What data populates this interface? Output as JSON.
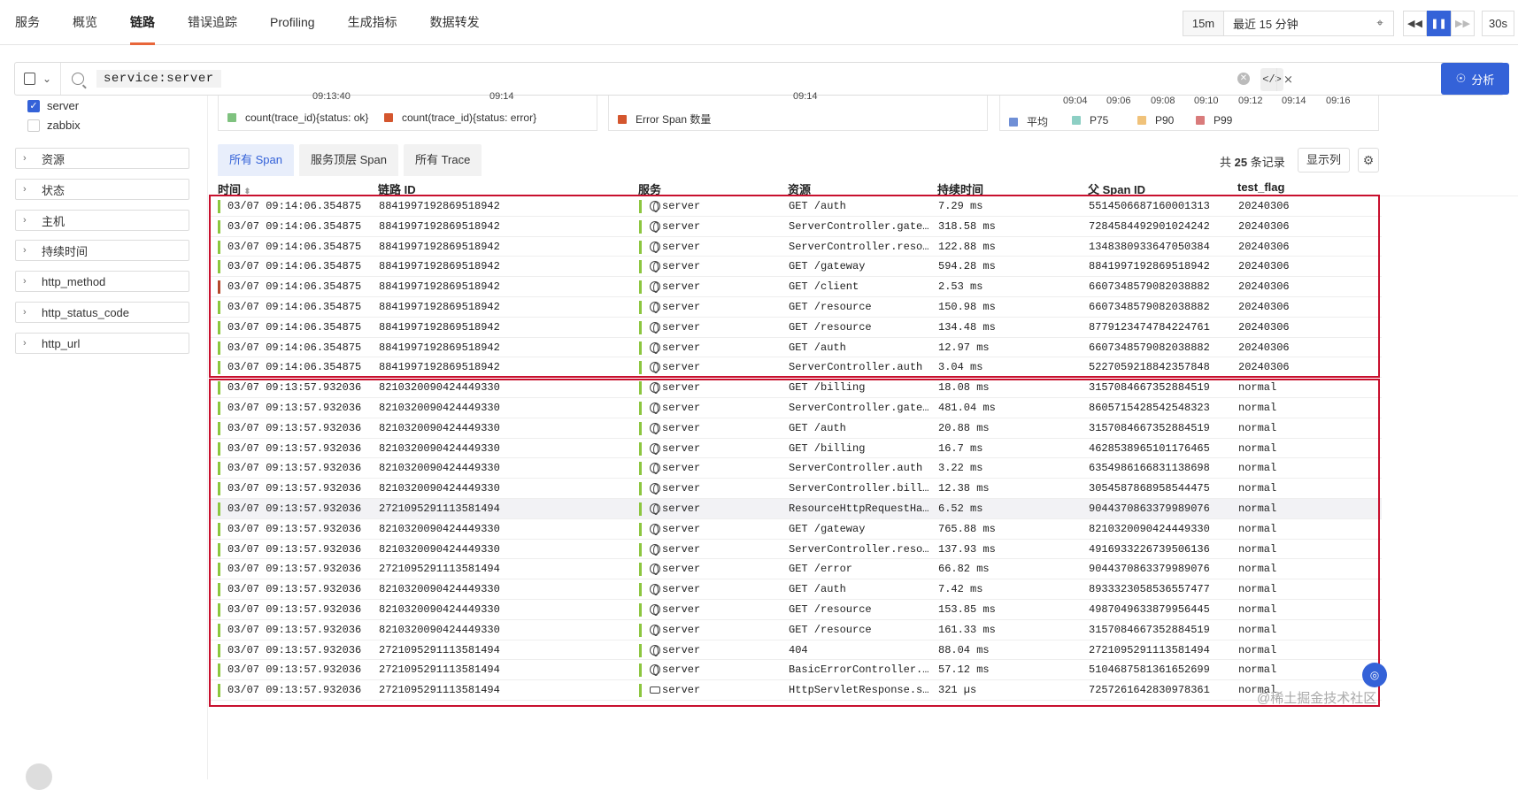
{
  "nav": {
    "tabs": [
      "服务",
      "概览",
      "链路",
      "错误追踪",
      "Profiling",
      "生成指标",
      "数据转发"
    ],
    "active": "链路"
  },
  "timectl": {
    "short": "15m",
    "range": "最近 15 分钟",
    "refresh": "30s"
  },
  "search": {
    "query": "service:server"
  },
  "analyze": {
    "label": "分析"
  },
  "sidebar": {
    "checks": [
      {
        "label": "server",
        "checked": true
      },
      {
        "label": "zabbix",
        "checked": false
      }
    ],
    "facets": [
      "资源",
      "状态",
      "主机",
      "持续时间",
      "http_method",
      "http_status_code",
      "http_url"
    ]
  },
  "charts": [
    {
      "ticks": [
        "09:13:40",
        "09:14"
      ],
      "legend": [
        {
          "name": "count(trace_id){status: ok}",
          "color": "#7fc27f"
        },
        {
          "name": "count(trace_id){status: error}",
          "color": "#d4562e"
        }
      ]
    },
    {
      "ticks": [
        "09:14"
      ],
      "legend": [
        {
          "name": "Error Span 数量",
          "color": "#d4562e"
        }
      ]
    },
    {
      "ticks": [
        "09:04",
        "09:06",
        "09:08",
        "09:10",
        "09:12",
        "09:14",
        "09:16"
      ],
      "legend": [
        {
          "name": "平均",
          "color": "#6f8fd6"
        },
        {
          "name": "P75",
          "color": "#8dcfc4"
        },
        {
          "name": "P90",
          "color": "#f0c27a"
        },
        {
          "name": "P99",
          "color": "#d97b7b"
        }
      ]
    }
  ],
  "subtabs": [
    "所有 Span",
    "服务顶层 Span",
    "所有 Trace"
  ],
  "records": {
    "prefix": "共",
    "count": "25",
    "suffix": "条记录"
  },
  "showcols": "显示列",
  "table": {
    "headers": [
      "时间",
      "链路 ID",
      "服务",
      "资源",
      "持续时间",
      "父 Span ID",
      "test_flag"
    ],
    "rows": [
      {
        "time": "03/07 09:14:06.354875",
        "trace": "8841997192869518942",
        "svc": "server",
        "res": "GET /auth",
        "dur": "7.29 ms",
        "parent": "5514506687160001313",
        "flag": "20240306",
        "err": false
      },
      {
        "time": "03/07 09:14:06.354875",
        "trace": "8841997192869518942",
        "svc": "server",
        "res": "ServerController.gate…",
        "dur": "318.58 ms",
        "parent": "7284584492901024242",
        "flag": "20240306",
        "err": false
      },
      {
        "time": "03/07 09:14:06.354875",
        "trace": "8841997192869518942",
        "svc": "server",
        "res": "ServerController.reso…",
        "dur": "122.88 ms",
        "parent": "1348380933647050384",
        "flag": "20240306",
        "err": false
      },
      {
        "time": "03/07 09:14:06.354875",
        "trace": "8841997192869518942",
        "svc": "server",
        "res": "GET /gateway",
        "dur": "594.28 ms",
        "parent": "8841997192869518942",
        "flag": "20240306",
        "err": false
      },
      {
        "time": "03/07 09:14:06.354875",
        "trace": "8841997192869518942",
        "svc": "server",
        "res": "GET /client",
        "dur": "2.53 ms",
        "parent": "6607348579082038882",
        "flag": "20240306",
        "err": true
      },
      {
        "time": "03/07 09:14:06.354875",
        "trace": "8841997192869518942",
        "svc": "server",
        "res": "GET /resource",
        "dur": "150.98 ms",
        "parent": "6607348579082038882",
        "flag": "20240306",
        "err": false
      },
      {
        "time": "03/07 09:14:06.354875",
        "trace": "8841997192869518942",
        "svc": "server",
        "res": "GET /resource",
        "dur": "134.48 ms",
        "parent": "8779123474784224761",
        "flag": "20240306",
        "err": false
      },
      {
        "time": "03/07 09:14:06.354875",
        "trace": "8841997192869518942",
        "svc": "server",
        "res": "GET /auth",
        "dur": "12.97 ms",
        "parent": "6607348579082038882",
        "flag": "20240306",
        "err": false
      },
      {
        "time": "03/07 09:14:06.354875",
        "trace": "8841997192869518942",
        "svc": "server",
        "res": "ServerController.auth",
        "dur": "3.04 ms",
        "parent": "5227059218842357848",
        "flag": "20240306",
        "err": false
      },
      {
        "time": "03/07 09:13:57.932036",
        "trace": "8210320090424449330",
        "svc": "server",
        "res": "GET /billing",
        "dur": "18.08 ms",
        "parent": "3157084667352884519",
        "flag": "normal",
        "err": false
      },
      {
        "time": "03/07 09:13:57.932036",
        "trace": "8210320090424449330",
        "svc": "server",
        "res": "ServerController.gate…",
        "dur": "481.04 ms",
        "parent": "8605715428542548323",
        "flag": "normal",
        "err": false
      },
      {
        "time": "03/07 09:13:57.932036",
        "trace": "8210320090424449330",
        "svc": "server",
        "res": "GET /auth",
        "dur": "20.88 ms",
        "parent": "3157084667352884519",
        "flag": "normal",
        "err": false
      },
      {
        "time": "03/07 09:13:57.932036",
        "trace": "8210320090424449330",
        "svc": "server",
        "res": "GET /billing",
        "dur": "16.7 ms",
        "parent": "4628538965101176465",
        "flag": "normal",
        "err": false
      },
      {
        "time": "03/07 09:13:57.932036",
        "trace": "8210320090424449330",
        "svc": "server",
        "res": "ServerController.auth",
        "dur": "3.22 ms",
        "parent": "6354986166831138698",
        "flag": "normal",
        "err": false
      },
      {
        "time": "03/07 09:13:57.932036",
        "trace": "8210320090424449330",
        "svc": "server",
        "res": "ServerController.bill…",
        "dur": "12.38 ms",
        "parent": "3054587868958544475",
        "flag": "normal",
        "err": false
      },
      {
        "time": "03/07 09:13:57.932036",
        "trace": "2721095291113581494",
        "svc": "server",
        "res": "ResourceHttpRequestHa…",
        "dur": "6.52 ms",
        "parent": "9044370863379989076",
        "flag": "normal",
        "err": false
      },
      {
        "time": "03/07 09:13:57.932036",
        "trace": "8210320090424449330",
        "svc": "server",
        "res": "GET /gateway",
        "dur": "765.88 ms",
        "parent": "8210320090424449330",
        "flag": "normal",
        "err": false
      },
      {
        "time": "03/07 09:13:57.932036",
        "trace": "8210320090424449330",
        "svc": "server",
        "res": "ServerController.reso…",
        "dur": "137.93 ms",
        "parent": "4916933226739506136",
        "flag": "normal",
        "err": false
      },
      {
        "time": "03/07 09:13:57.932036",
        "trace": "2721095291113581494",
        "svc": "server",
        "res": "GET /error",
        "dur": "66.82 ms",
        "parent": "9044370863379989076",
        "flag": "normal",
        "err": false
      },
      {
        "time": "03/07 09:13:57.932036",
        "trace": "8210320090424449330",
        "svc": "server",
        "res": "GET /auth",
        "dur": "7.42 ms",
        "parent": "8933323058536557477",
        "flag": "normal",
        "err": false
      },
      {
        "time": "03/07 09:13:57.932036",
        "trace": "8210320090424449330",
        "svc": "server",
        "res": "GET /resource",
        "dur": "153.85 ms",
        "parent": "4987049633879956445",
        "flag": "normal",
        "err": false
      },
      {
        "time": "03/07 09:13:57.932036",
        "trace": "8210320090424449330",
        "svc": "server",
        "res": "GET /resource",
        "dur": "161.33 ms",
        "parent": "3157084667352884519",
        "flag": "normal",
        "err": false
      },
      {
        "time": "03/07 09:13:57.932036",
        "trace": "2721095291113581494",
        "svc": "server",
        "res": "404",
        "dur": "88.04 ms",
        "parent": "2721095291113581494",
        "flag": "normal",
        "err": false
      },
      {
        "time": "03/07 09:13:57.932036",
        "trace": "2721095291113581494",
        "svc": "server",
        "res": "BasicErrorController.…",
        "dur": "57.12 ms",
        "parent": "5104687581361652699",
        "flag": "normal",
        "err": false
      },
      {
        "time": "03/07 09:13:57.932036",
        "trace": "2721095291113581494",
        "svc": "server",
        "res": "HttpServletResponse.s…",
        "dur": "321 µs",
        "parent": "7257261642830978361",
        "flag": "normal",
        "err": false
      }
    ]
  },
  "watermark": "@稀土掘金技术社区"
}
